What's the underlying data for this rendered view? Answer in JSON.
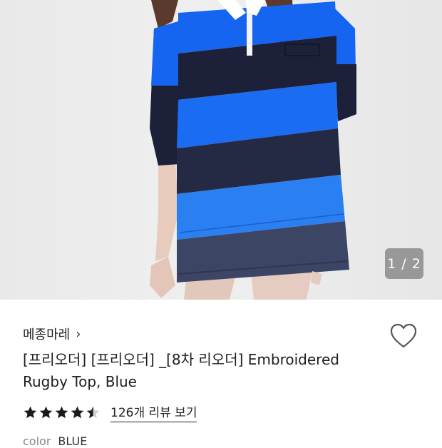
{
  "image": {
    "counter": "1 / 2",
    "stripe_colors": [
      "#1565f0",
      "#1c2038",
      "#1a6cf2",
      "#252a44",
      "#2a80f0",
      "#3c4563"
    ]
  },
  "product": {
    "brand": "메종마레",
    "brand_chevron": "›",
    "title": "[프리오더] [프리오더] _[8차 리오더] Embroidered Rugby Top, Blue",
    "rating": 4.5,
    "reviews_label": "126개 리뷰 보기",
    "option_label": "color",
    "option_value": "BLUE"
  },
  "colors": {
    "star": "#1a1a1a",
    "heart_stroke": "#555555"
  }
}
